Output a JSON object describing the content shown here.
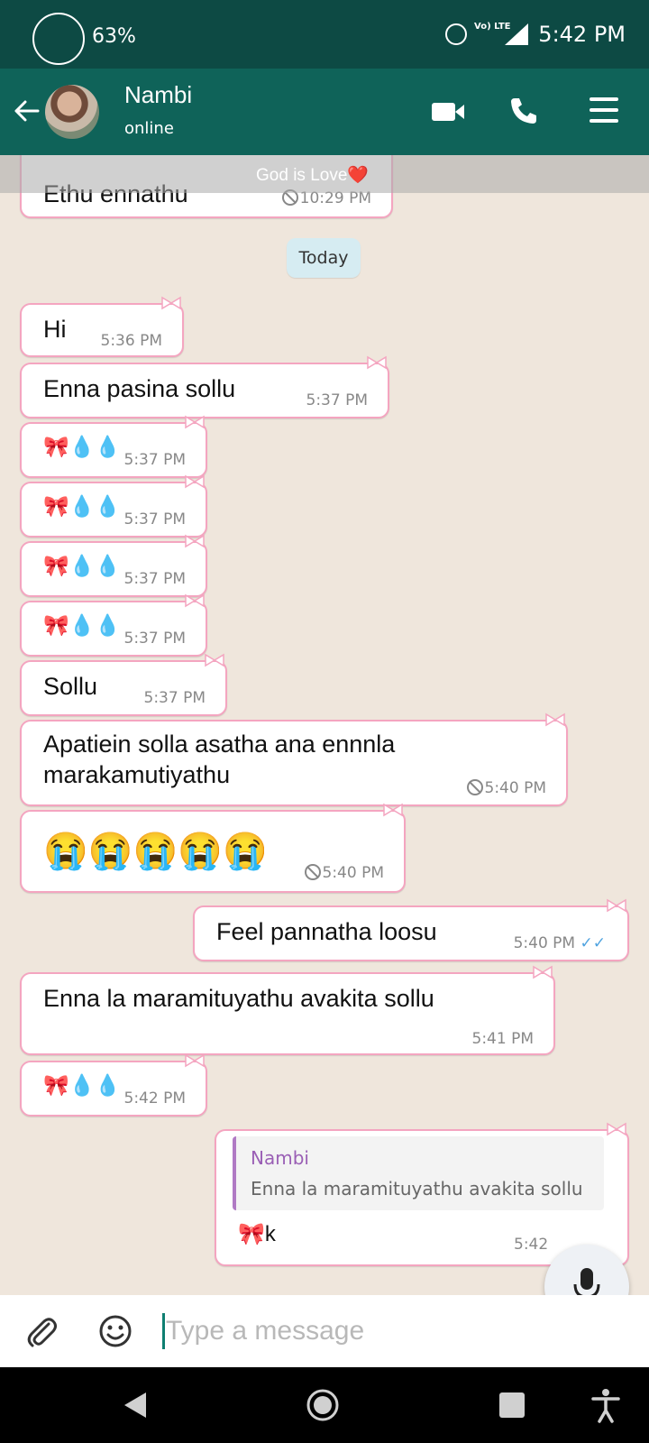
{
  "status_bar": {
    "battery": "63%",
    "volte": "Vo) LTE",
    "time": "5:42 PM"
  },
  "header": {
    "contact_name": "Nambi",
    "contact_status": "online"
  },
  "overlay": {
    "caption": "God is Love❤️"
  },
  "chat": {
    "date_chip": "Today",
    "messages": [
      {
        "dir": "in",
        "text": "Ethu ennathu",
        "time": "10:29 PM",
        "deleted_icon": true
      },
      {
        "dir": "in",
        "text": "Hi",
        "time": "5:36 PM"
      },
      {
        "dir": "in",
        "text": "Enna pasina sollu",
        "time": "5:37 PM"
      },
      {
        "dir": "in",
        "text": "🎀💧💧",
        "time": "5:37 PM"
      },
      {
        "dir": "in",
        "text": "🎀💧💧",
        "time": "5:37 PM"
      },
      {
        "dir": "in",
        "text": "🎀💧💧",
        "time": "5:37 PM"
      },
      {
        "dir": "in",
        "text": "🎀💧💧",
        "time": "5:37 PM"
      },
      {
        "dir": "in",
        "text": "Sollu",
        "time": "5:37 PM"
      },
      {
        "dir": "in",
        "text": "Apatiein solla asatha ana ennnla",
        "text2": "marakamutiyathu",
        "time": "5:40 PM",
        "deleted_icon": true
      },
      {
        "dir": "in",
        "text": "😭😭😭😭😭",
        "time": "5:40 PM",
        "deleted_icon": true
      },
      {
        "dir": "out",
        "text": "Feel pannatha loosu",
        "time": "5:40 PM",
        "ticks": "✓✓"
      },
      {
        "dir": "in",
        "text": "Enna la maramituyathu avakita sollu",
        "time": "5:41 PM"
      },
      {
        "dir": "in",
        "text": "🎀💧💧",
        "time": "5:42 PM"
      },
      {
        "dir": "out",
        "quote_name": "Nambi",
        "quote_text": "Enna la maramituyathu avakita sollu",
        "text": "🎀k",
        "time": "5:42"
      }
    ]
  },
  "composer": {
    "placeholder": "Type a message"
  },
  "colors": {
    "status_bar": "#0d4a44",
    "header": "#0f6359",
    "bubble_border": "#f4a5c0",
    "read_ticks": "#4fa3e0",
    "quote_bar": "#b07ac4"
  },
  "icons": [
    "back-arrow-icon",
    "video-call-icon",
    "phone-icon",
    "menu-icon",
    "attach-icon",
    "emoji-icon",
    "mic-icon",
    "nav-back-icon",
    "nav-home-icon",
    "nav-recents-icon",
    "accessibility-icon"
  ]
}
